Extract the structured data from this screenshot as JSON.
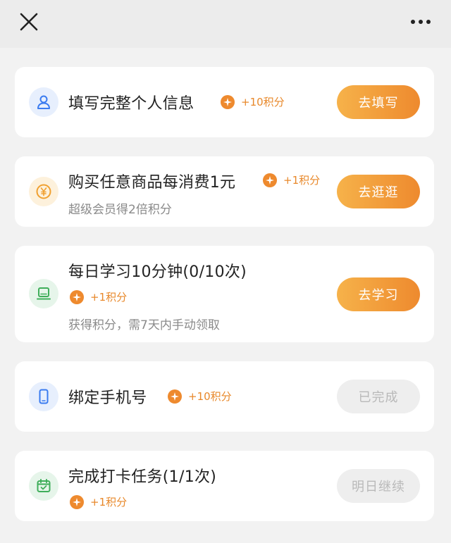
{
  "header": {
    "close_icon": "close-icon",
    "more_icon": "more-icon"
  },
  "colors": {
    "accent": "#ee8a2e",
    "accent_light": "#f6b24a",
    "done_bg": "#eeeeee"
  },
  "tasks": [
    {
      "icon": "user-icon",
      "title": "填写完整个人信息",
      "points": "+10积分",
      "subtitle": "",
      "action": "去填写",
      "completed": false
    },
    {
      "icon": "yuan-coin-icon",
      "title": "购买任意商品每消费1元",
      "points": "+1积分",
      "subtitle": "超级会员得2倍积分",
      "action": "去逛逛",
      "completed": false
    },
    {
      "icon": "study-laptop-icon",
      "title": "每日学习10分钟(0/10次)",
      "points": "+1积分",
      "subtitle": "获得积分，需7天内手动领取",
      "action": "去学习",
      "completed": false
    },
    {
      "icon": "phone-icon",
      "title": "绑定手机号",
      "points": "+10积分",
      "subtitle": "",
      "action": "已完成",
      "completed": true
    },
    {
      "icon": "calendar-check-icon",
      "title": "完成打卡任务(1/1次)",
      "points": "+1积分",
      "subtitle": "",
      "action": "明日继续",
      "completed": true
    }
  ]
}
